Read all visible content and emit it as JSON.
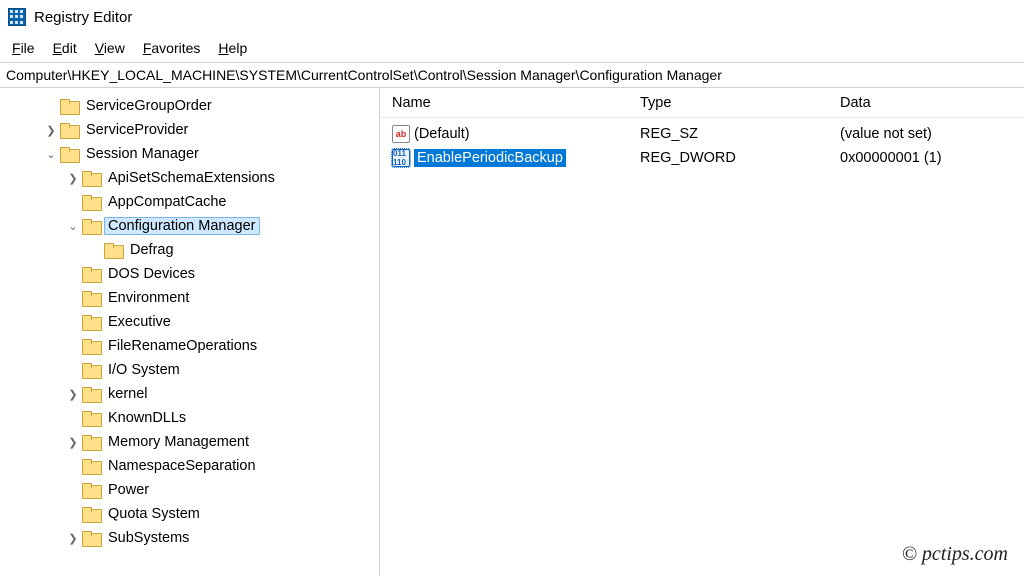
{
  "window": {
    "title": "Registry Editor"
  },
  "menubar": {
    "items": [
      {
        "accel": "F",
        "rest": "ile"
      },
      {
        "accel": "E",
        "rest": "dit"
      },
      {
        "accel": "V",
        "rest": "iew"
      },
      {
        "accel": "F",
        "rest": "avorites"
      },
      {
        "accel": "H",
        "rest": "elp"
      }
    ]
  },
  "addressbar": {
    "path": "Computer\\HKEY_LOCAL_MACHINE\\SYSTEM\\CurrentControlSet\\Control\\Session Manager\\Configuration Manager"
  },
  "tree": {
    "nodes": [
      {
        "depth": 2,
        "exp": "",
        "label": "ServiceGroupOrder",
        "sel": false
      },
      {
        "depth": 2,
        "exp": ">",
        "label": "ServiceProvider",
        "sel": false
      },
      {
        "depth": 2,
        "exp": "v",
        "label": "Session Manager",
        "sel": false
      },
      {
        "depth": 3,
        "exp": ">",
        "label": "ApiSetSchemaExtensions",
        "sel": false
      },
      {
        "depth": 3,
        "exp": "",
        "label": "AppCompatCache",
        "sel": false
      },
      {
        "depth": 3,
        "exp": "v",
        "label": "Configuration Manager",
        "sel": true
      },
      {
        "depth": 4,
        "exp": "",
        "label": "Defrag",
        "sel": false
      },
      {
        "depth": 3,
        "exp": "",
        "label": "DOS Devices",
        "sel": false
      },
      {
        "depth": 3,
        "exp": "",
        "label": "Environment",
        "sel": false
      },
      {
        "depth": 3,
        "exp": "",
        "label": "Executive",
        "sel": false
      },
      {
        "depth": 3,
        "exp": "",
        "label": "FileRenameOperations",
        "sel": false
      },
      {
        "depth": 3,
        "exp": "",
        "label": "I/O System",
        "sel": false
      },
      {
        "depth": 3,
        "exp": ">",
        "label": "kernel",
        "sel": false
      },
      {
        "depth": 3,
        "exp": "",
        "label": "KnownDLLs",
        "sel": false
      },
      {
        "depth": 3,
        "exp": ">",
        "label": "Memory Management",
        "sel": false
      },
      {
        "depth": 3,
        "exp": "",
        "label": "NamespaceSeparation",
        "sel": false
      },
      {
        "depth": 3,
        "exp": "",
        "label": "Power",
        "sel": false
      },
      {
        "depth": 3,
        "exp": "",
        "label": "Quota System",
        "sel": false
      },
      {
        "depth": 3,
        "exp": ">",
        "label": "SubSystems",
        "sel": false
      }
    ]
  },
  "list": {
    "headers": {
      "name": "Name",
      "type": "Type",
      "data": "Data"
    },
    "rows": [
      {
        "icon": "str",
        "name": "(Default)",
        "type": "REG_SZ",
        "data": "(value not set)",
        "sel": false
      },
      {
        "icon": "dw",
        "name": "EnablePeriodicBackup",
        "type": "REG_DWORD",
        "data": "0x00000001 (1)",
        "sel": true
      }
    ]
  },
  "watermark": "© pctips.com"
}
